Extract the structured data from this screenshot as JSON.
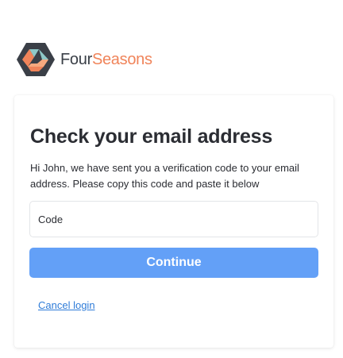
{
  "brand": {
    "name_part1": "Four",
    "name_part2": "Seasons",
    "logo_icon": "fourseasons-hexagon-logo",
    "colors": {
      "text_dark": "#3a3f47",
      "accent": "#f0845a",
      "logo_teal": "#8ec8c8"
    }
  },
  "card": {
    "title": "Check your email address",
    "message": "Hi John, we have sent you a verification code to your email address. Please copy this code and paste it below",
    "code_field": {
      "value": "",
      "placeholder": "Code"
    },
    "continue_label": "Continue",
    "cancel_label": "Cancel login"
  },
  "colors": {
    "primary_button": "#63a0f7",
    "link": "#2f7cd8"
  }
}
